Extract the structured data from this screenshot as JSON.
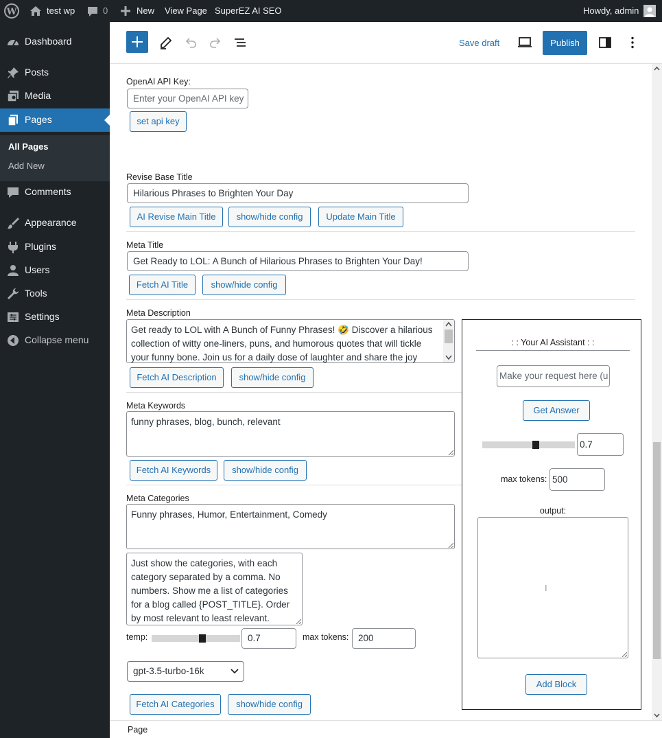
{
  "admin_bar": {
    "site_name": "test wp",
    "comments_count": "0",
    "new_label": "New",
    "view_page_label": "View Page",
    "plugin_label": "SuperEZ AI SEO",
    "howdy_label": "Howdy, admin"
  },
  "sidebar": {
    "items": [
      {
        "label": "Dashboard",
        "icon": "dashboard-icon"
      },
      {
        "label": "Posts",
        "icon": "pin-icon"
      },
      {
        "label": "Media",
        "icon": "media-icon"
      },
      {
        "label": "Pages",
        "icon": "pages-icon"
      },
      {
        "label": "Comments",
        "icon": "comment-icon"
      },
      {
        "label": "Appearance",
        "icon": "brush-icon"
      },
      {
        "label": "Plugins",
        "icon": "plug-icon"
      },
      {
        "label": "Users",
        "icon": "user-icon"
      },
      {
        "label": "Tools",
        "icon": "wrench-icon"
      },
      {
        "label": "Settings",
        "icon": "settings-icon"
      },
      {
        "label": "Collapse menu",
        "icon": "collapse-icon"
      }
    ],
    "submenu": [
      {
        "label": "All Pages"
      },
      {
        "label": "Add New"
      }
    ]
  },
  "toolbar": {
    "save_draft_label": "Save draft",
    "publish_label": "Publish"
  },
  "seo_form": {
    "api_key": {
      "label": "OpenAI API Key:",
      "placeholder": "Enter your OpenAI API key",
      "button": "set api key"
    },
    "base_title": {
      "label": "Revise Base Title",
      "value": "Hilarious Phrases to Brighten Your Day",
      "buttons": [
        "AI Revise Main Title",
        "show/hide config",
        "Update Main Title"
      ]
    },
    "meta_title": {
      "label": "Meta Title",
      "value": "Get Ready to LOL: A Bunch of Hilarious Phrases to Brighten Your Day!",
      "buttons": [
        "Fetch AI Title",
        "show/hide config"
      ]
    },
    "meta_description": {
      "label": "Meta Description",
      "lines": [
        "Get ready to LOL with A Bunch of Funny Phrases! 🤣 Discover a hilarious",
        "collection of witty one-liners, puns, and humorous quotes that will tickle",
        "your funny bone. Join us for a daily dose of laughter and share the joy"
      ],
      "buttons": [
        "Fetch AI Description",
        "show/hide config"
      ]
    },
    "meta_keywords": {
      "label": "Meta Keywords",
      "value": "funny phrases, blog, bunch, relevant",
      "buttons": [
        "Fetch AI Keywords",
        "show/hide config"
      ]
    },
    "meta_categories": {
      "label": "Meta Categories",
      "value": "Funny phrases, Humor, Entertainment, Comedy",
      "prompt_lines": [
        "Just show the categories, with each",
        "category separated by a comma. No",
        "numbers. Show me a list of categories",
        "for a blog called {POST_TITLE}. Order",
        "by most relevant to least relevant."
      ],
      "temp_label": "temp:",
      "temp_value": "0.7",
      "temp_fraction": 0.58,
      "max_tokens_label": "max tokens:",
      "max_tokens_value": "200",
      "model": "gpt-3.5-turbo-16k",
      "buttons": [
        "Fetch AI Categories",
        "show/hide config"
      ]
    }
  },
  "ai_assistant": {
    "title": ": : Your AI Assistant : :",
    "request_placeholder": "Make your request here (u",
    "get_answer_label": "Get Answer",
    "temp_value": "0.7",
    "temp_fraction": 0.58,
    "max_tokens_label": "max tokens:",
    "max_tokens_value": "500",
    "output_label": "output:",
    "add_block_label": "Add Block"
  },
  "footer": {
    "breadcrumb": "Page"
  },
  "colors": {
    "admin_bg": "#1d2327",
    "accent": "#2271b1",
    "button_bg": "#f6f7f7"
  }
}
